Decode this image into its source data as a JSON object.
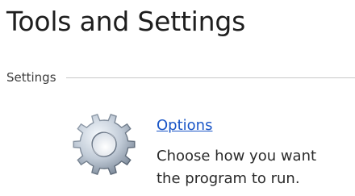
{
  "page": {
    "title": "Tools and Settings"
  },
  "settings_group": {
    "label": "Settings",
    "items": [
      {
        "icon": "gear-icon",
        "label": "Options",
        "description_line1": "Choose how you want",
        "description_line2": "the program to run."
      }
    ]
  },
  "colors": {
    "link": "#1a56c7",
    "title": "#1e1e1e",
    "divider": "#c8c8c8"
  }
}
